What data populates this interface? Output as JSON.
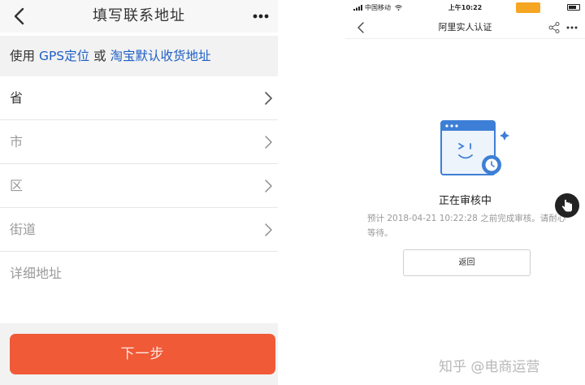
{
  "left_phone": {
    "header": {
      "title": "填写联系地址"
    },
    "gps_bar": {
      "prefix": "使用",
      "gps_link": "GPS定位",
      "connector": "或",
      "taobao_link": "淘宝默认收货地址"
    },
    "fields": [
      {
        "label": "省"
      },
      {
        "label": "市"
      },
      {
        "label": "区"
      },
      {
        "label": "街道"
      },
      {
        "label": "详细地址"
      }
    ],
    "next_button": "下一步",
    "colors": {
      "accent": "#f05a37",
      "link": "#1e5fc7"
    }
  },
  "right_phone": {
    "status_bar": {
      "carrier": "中国移动",
      "time": "上午10:22",
      "badge": "",
      "icons": [
        "wifi-icon",
        "battery-icon"
      ]
    },
    "header": {
      "title": "阿里实人认证",
      "icons": [
        "back-icon",
        "share-icon",
        "more-icon"
      ]
    },
    "status_title": "正在审核中",
    "status_desc": "预计 2018-04-21 10:22:28 之前完成审核。请耐心等待。",
    "return_button": "返回",
    "colors": {
      "illustration": "#3d7fd6"
    }
  },
  "watermark": "知乎 @电商运营"
}
